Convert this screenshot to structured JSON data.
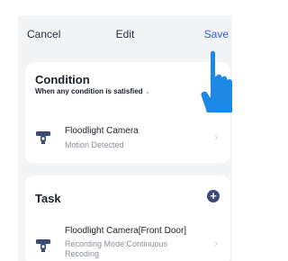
{
  "header": {
    "cancel_label": "Cancel",
    "title": "Edit",
    "save_label": "Save"
  },
  "condition": {
    "title": "Condition",
    "subtitle": "When any condition is satisfied",
    "subtitle_chevron": "⌄",
    "item": {
      "name": "Floodlight Camera",
      "sub": "Motion Detected",
      "icon": "camera-icon"
    }
  },
  "task": {
    "title": "Task",
    "add_label": "+",
    "item": {
      "name": "Floodlight Camera[Front Door]",
      "sub": "Recording Mode:Continuous Recoding",
      "icon": "camera-icon"
    }
  },
  "colors": {
    "accent": "#2d5fe8",
    "background": "#f3f4f6",
    "card": "#ffffff",
    "add_button": "#3c4a78",
    "pointer_hand": "#1e88e5"
  },
  "icons": [
    "camera-icon",
    "chevron-right-icon",
    "plus-circle-icon",
    "pointing-hand-icon"
  ]
}
